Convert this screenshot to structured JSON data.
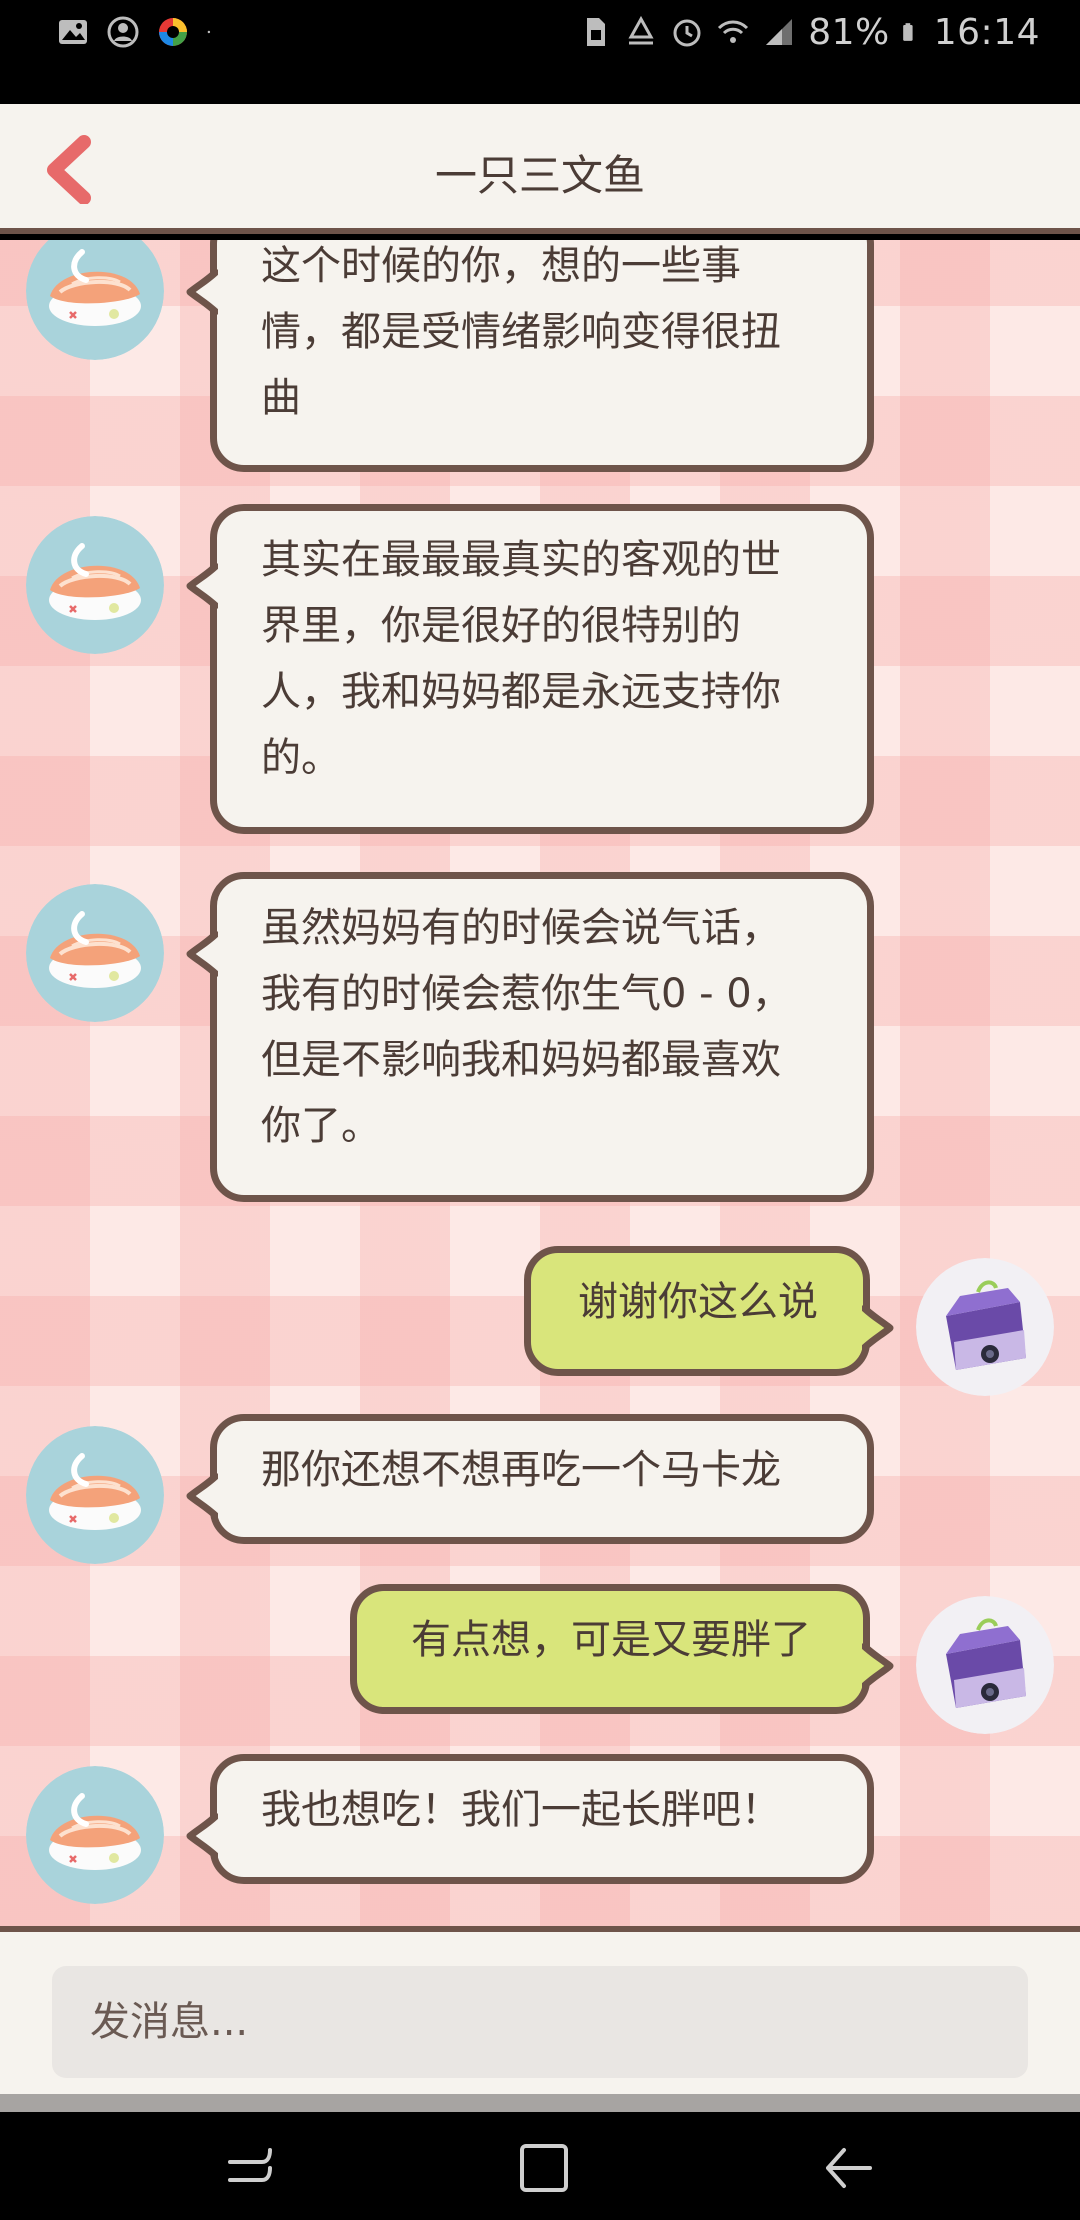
{
  "status_bar": {
    "battery": "81%",
    "time": "16:14",
    "icons": [
      "gallery-icon",
      "account-icon",
      "app-color-icon",
      "dot-icon",
      "sim-icon",
      "recycle-icon",
      "alarm-icon",
      "wifi-icon",
      "signal-icon",
      "battery-icon"
    ]
  },
  "header": {
    "title": "一只三文鱼",
    "back_icon": "chevron-left-icon",
    "accent_color": "#e76a6a"
  },
  "messages": [
    {
      "side": "in",
      "lines": [
        "这个时候的你，想的一些事",
        "情，都是受情绪影响变得很扭",
        "曲"
      ]
    },
    {
      "side": "in",
      "lines": [
        "其实在最最最真实的客观的世",
        "界里，你是很好的很特别的",
        "人，我和妈妈都是永远支持你",
        "的。"
      ]
    },
    {
      "side": "in",
      "lines": [
        "虽然妈妈有的时候会说气话，",
        "我有的时候会惹你生气0 - 0，",
        "但是不影响我和妈妈都最喜欢",
        "你了。"
      ]
    },
    {
      "side": "out",
      "lines": [
        "谢谢你这么说"
      ]
    },
    {
      "side": "in",
      "lines": [
        "那你还想不想再吃一个马卡龙"
      ]
    },
    {
      "side": "out",
      "lines": [
        "有点想，可是又要胖了"
      ]
    },
    {
      "side": "in",
      "lines": [
        "我也想吃！我们一起长胖吧！"
      ]
    }
  ],
  "composer": {
    "placeholder": "发消息..."
  },
  "nav": {
    "recents_icon": "recents-icon",
    "home_icon": "home-icon",
    "back_icon": "back-arrow-icon"
  },
  "colors": {
    "bubble_in": "#f6f3ee",
    "bubble_out": "#d9e57b",
    "border": "#6e544a",
    "background_pink": "#fde9e6"
  }
}
